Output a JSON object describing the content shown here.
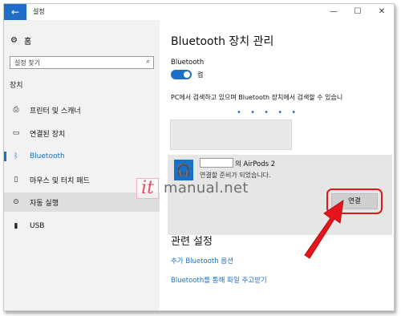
{
  "window": {
    "back_glyph": "←",
    "title": "설정",
    "controls": {
      "minimize": "—",
      "maximize": "☐",
      "close": "✕"
    }
  },
  "sidebar": {
    "home_icon": "gear-icon",
    "home_label": "홈",
    "search": {
      "placeholder": "설정 찾기",
      "icon": "search-icon"
    },
    "section_label": "장치",
    "items": [
      {
        "label": "프린터 및 스캐너",
        "icon": "printer-icon"
      },
      {
        "label": "연결된 장치",
        "icon": "devices-icon"
      },
      {
        "label": "Bluetooth",
        "icon": "bluetooth-icon",
        "active": true
      },
      {
        "label": "마우스 및 터치 패드",
        "icon": "mouse-icon"
      },
      {
        "label": "자동 실행",
        "icon": "autoplay-icon",
        "selected": true
      },
      {
        "label": "USB",
        "icon": "usb-icon"
      }
    ]
  },
  "main": {
    "title": "Bluetooth 장치 관리",
    "bluetooth_label": "Bluetooth",
    "toggle_state": "켬",
    "description": "PC에서 검색하고 있으며 Bluetooth 장치에서 검색할 수 있습니",
    "device": {
      "name": "의 AirPods 2",
      "status": "연결할 준비가 되었습니다.",
      "connect_label": "연결"
    },
    "related": {
      "title": "관련 설정",
      "links": [
        "추가 Bluetooth 옵션",
        "Bluetooth를 통해 파일 주고받기"
      ]
    }
  },
  "watermark": {
    "it": "it",
    "site": "manual.net"
  },
  "colors": {
    "accent": "#1a6fc6",
    "highlight": "#e4161b"
  }
}
